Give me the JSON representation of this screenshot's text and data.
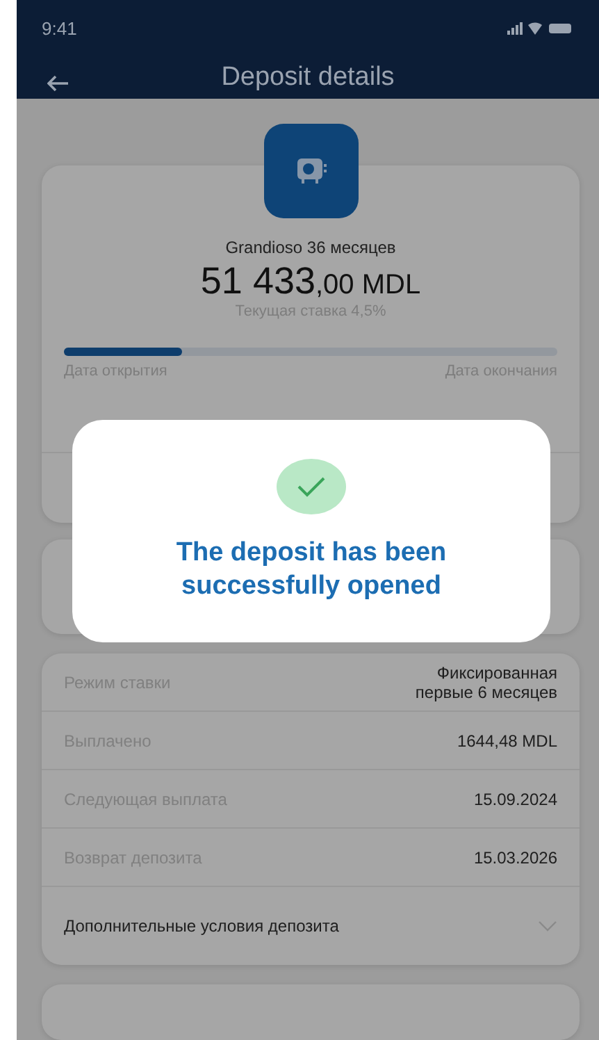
{
  "status_bar": {
    "time": "9:41"
  },
  "header": {
    "title": "Deposit details"
  },
  "deposit": {
    "name": "Grandioso 36 месяцев",
    "amount": "51 433",
    "cents": ",00 MDL",
    "rate": "Текущая ставка 4,5%",
    "progress": {
      "level": 0.24
    },
    "open_label": "Дата открытия",
    "close_label": "Дата окончания"
  },
  "details": [
    {
      "label": "Режим ставки",
      "value": "Фиксированная\nпервые 6 месяцев"
    },
    {
      "label": "Выплачено",
      "value": "1644,48 MDL"
    },
    {
      "label": "Следующая выплата",
      "value": "15.09.2024"
    },
    {
      "label": "Возврат депозита",
      "value": "15.03.2026"
    }
  ],
  "conditions": {
    "label": "Дополнительные условия депозита",
    "expanded": false
  },
  "dialog": {
    "message": "The deposit has been successfully opened"
  }
}
